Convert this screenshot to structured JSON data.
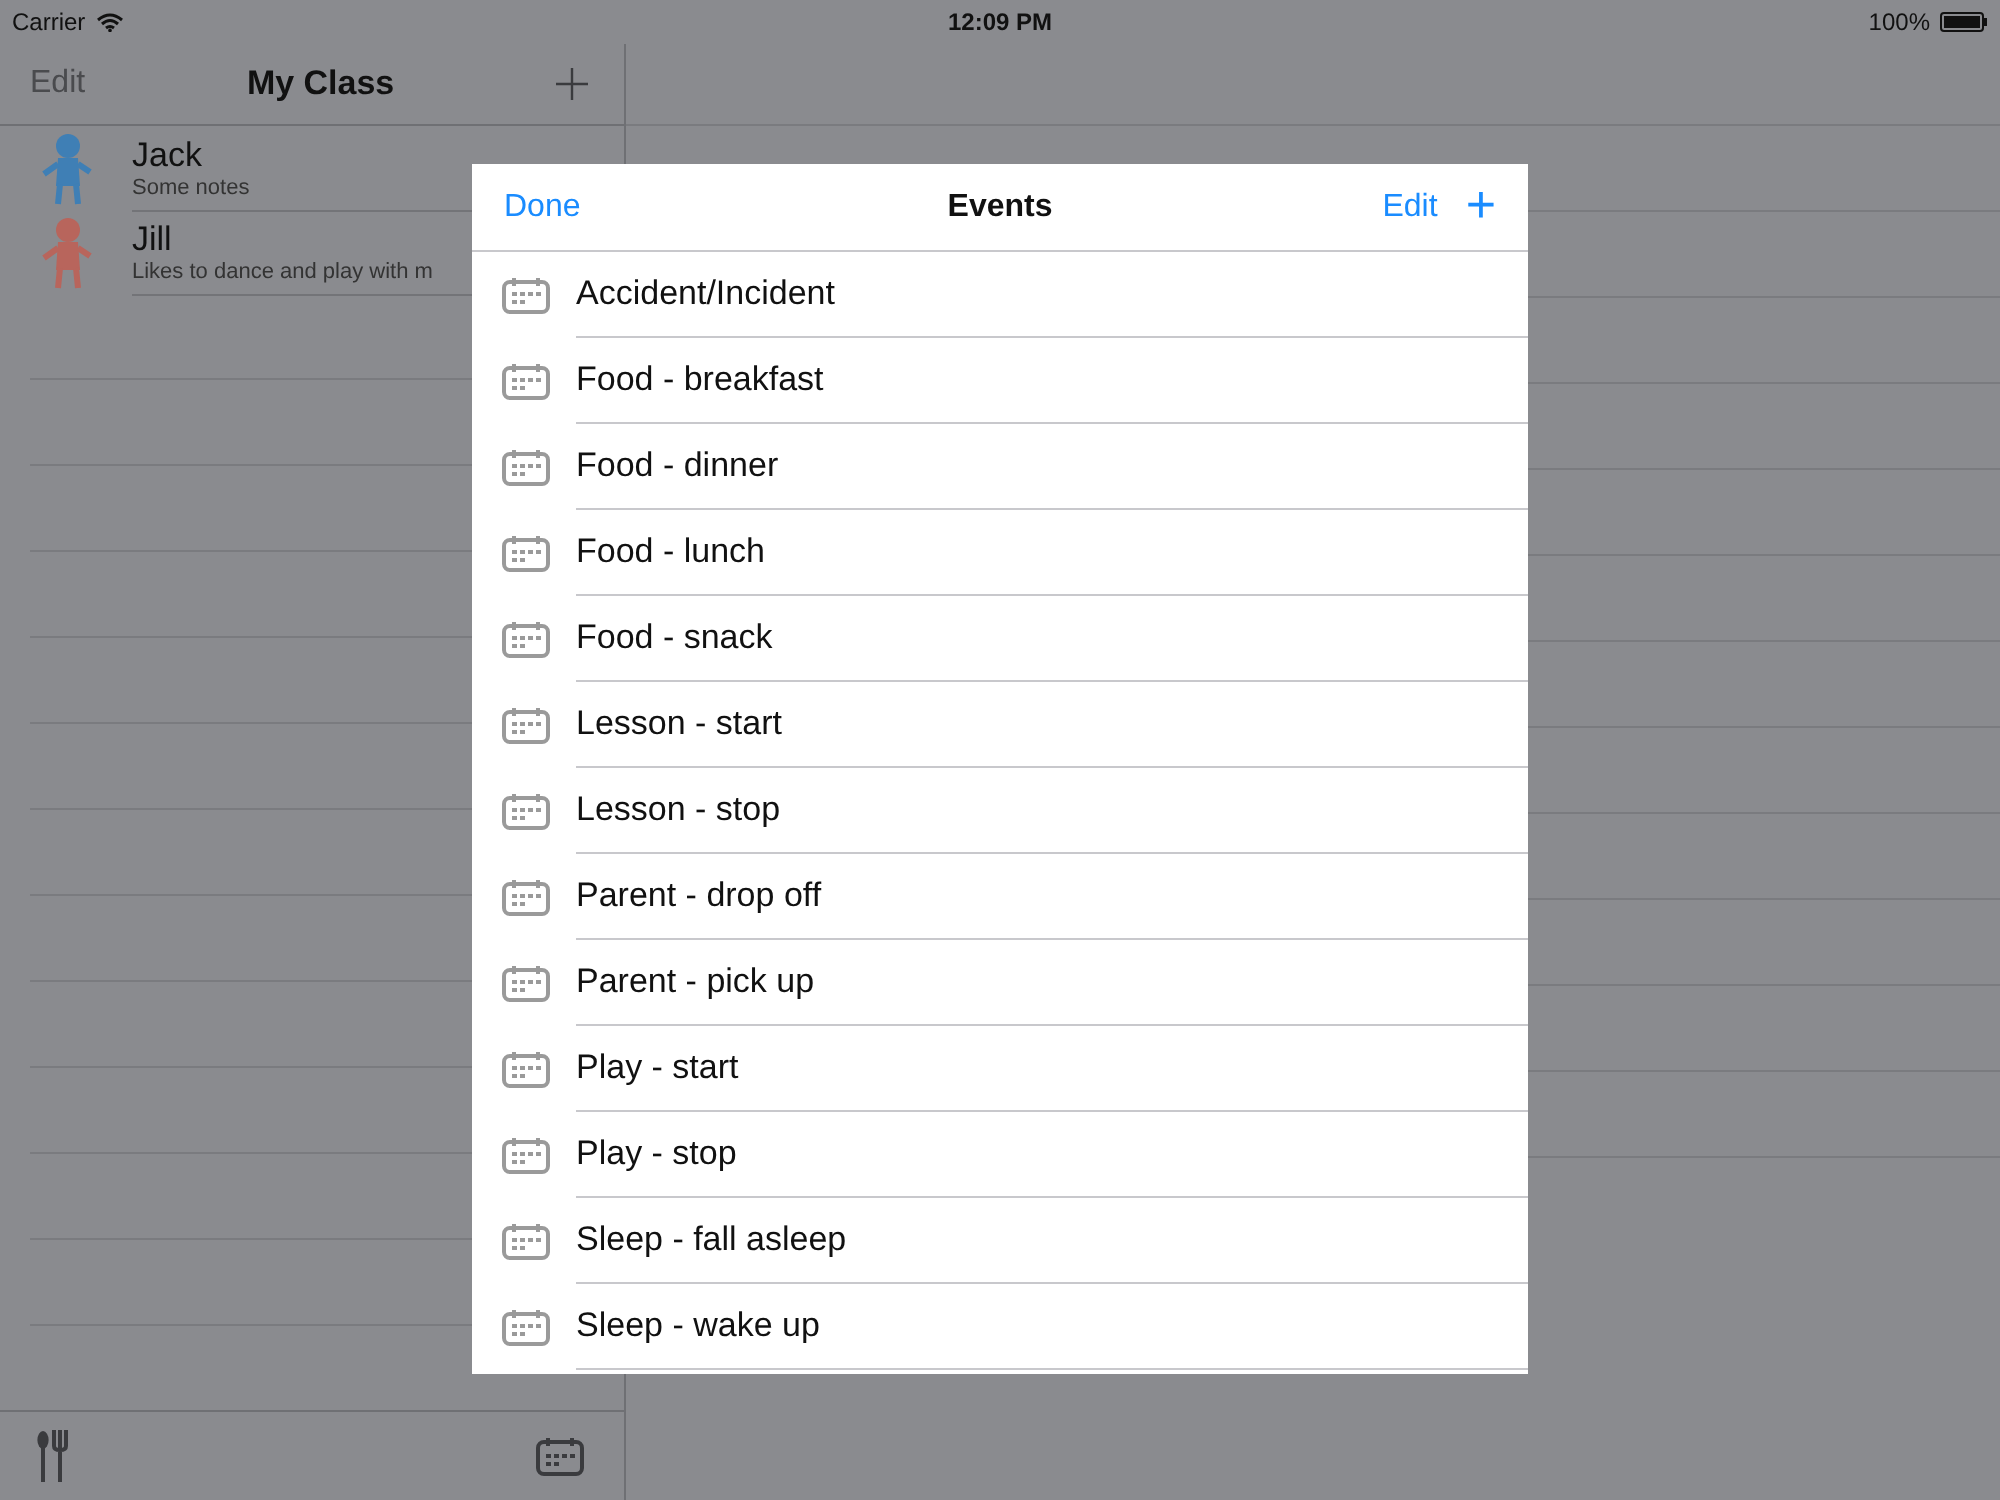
{
  "status_bar": {
    "carrier": "Carrier",
    "time": "12:09 PM",
    "battery": "100%"
  },
  "master": {
    "edit": "Edit",
    "title": "My Class",
    "students": [
      {
        "name": "Jack",
        "notes": "Some notes",
        "color": "#3f7fb5"
      },
      {
        "name": "Jill",
        "notes": "Likes to dance and play with m",
        "color": "#b8655c"
      }
    ]
  },
  "events_popover": {
    "done": "Done",
    "title": "Events",
    "edit": "Edit",
    "add": "+",
    "items": [
      "Accident/Incident",
      "Food - breakfast",
      "Food - dinner",
      "Food - lunch",
      "Food - snack",
      "Lesson - start",
      "Lesson - stop",
      "Parent - drop off",
      "Parent - pick up",
      "Play - start",
      "Play - stop",
      "Sleep - fall asleep",
      "Sleep - wake up"
    ]
  }
}
